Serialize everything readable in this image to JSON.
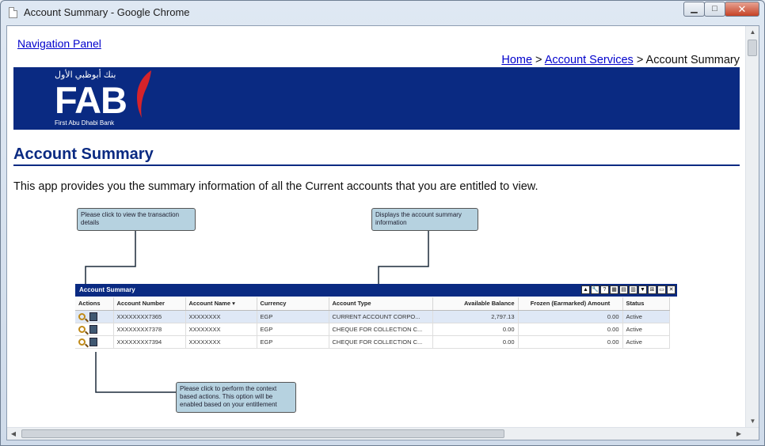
{
  "window": {
    "title": "Account Summary - Google Chrome",
    "minimize": "▁",
    "maximize": "□",
    "close": "✕"
  },
  "page": {
    "nav_link": "Navigation Panel",
    "breadcrumb": {
      "home": "Home",
      "sep1": " > ",
      "services": "Account Services",
      "sep2": " > ",
      "current": "Account Summary"
    },
    "banner": {
      "arabic": "بنك أبوظبي الأول",
      "logo": "FAB",
      "subtitle": "First Abu Dhabi Bank",
      "brand_color": "#0a2a82",
      "accent_color": "#d6232a"
    },
    "title": "Account Summary",
    "intro": "This app provides you the summary information of all the Current accounts that you are entitled to view."
  },
  "callouts": {
    "view_details": "Please click to view the transaction details",
    "summary_info": "Displays the account summary information",
    "context_actions": "Please click to perform the context based actions. This option will be enabled based on your entitlement"
  },
  "widget": {
    "title": "Account Summary",
    "tools": [
      "▲",
      "🔧",
      "?",
      "▦",
      "▤",
      "▥",
      "▼",
      "⊞",
      "▭",
      "✕"
    ],
    "columns": [
      "Actions",
      "Account Number",
      "Account Name ▾",
      "Currency",
      "Account Type",
      "Available Balance",
      "Frozen (Earmarked) Amount",
      "Status"
    ],
    "rows": [
      {
        "number": "XXXXXXXX7365",
        "name": "XXXXXXXX",
        "currency": "EGP",
        "type": "CURRENT ACCOUNT CORPO...",
        "balance": "2,797.13",
        "frozen": "0.00",
        "status": "Active"
      },
      {
        "number": "XXXXXXXX7378",
        "name": "XXXXXXXX",
        "currency": "EGP",
        "type": "CHEQUE FOR COLLECTION C...",
        "balance": "0.00",
        "frozen": "0.00",
        "status": "Active"
      },
      {
        "number": "XXXXXXXX7394",
        "name": "XXXXXXXX",
        "currency": "EGP",
        "type": "CHEQUE FOR COLLECTION C...",
        "balance": "0.00",
        "frozen": "0.00",
        "status": "Active"
      }
    ]
  },
  "icons": {
    "view": "magnifier-icon",
    "context": "context-menu-icon",
    "tab": "page-icon"
  }
}
